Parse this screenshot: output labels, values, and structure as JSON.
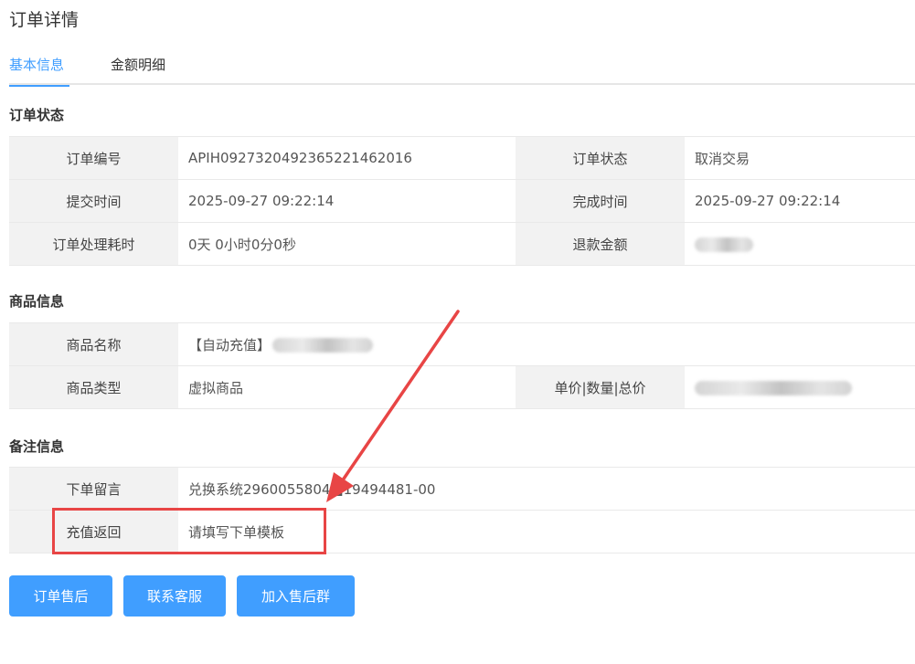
{
  "page": {
    "title": "订单详情"
  },
  "tabs": [
    {
      "label": "基本信息",
      "active": true
    },
    {
      "label": "金额明细",
      "active": false
    }
  ],
  "order_status": {
    "title": "订单状态",
    "order_no_label": "订单编号",
    "order_no": "APIH0927320492365221462016",
    "status_label": "订单状态",
    "status": "取消交易",
    "submit_time_label": "提交时间",
    "submit_time": "2025-09-27 09:22:14",
    "finish_time_label": "完成时间",
    "finish_time": "2025-09-27 09:22:14",
    "duration_label": "订单处理耗时",
    "duration": "0天 0小时0分0秒",
    "refund_label": "退款金额"
  },
  "product_info": {
    "title": "商品信息",
    "name_label": "商品名称",
    "name_prefix": "【自动充值】",
    "type_label": "商品类型",
    "type": "虚拟商品",
    "price_label": "单价|数量|总价"
  },
  "remark_info": {
    "title": "备注信息",
    "message_label": "下单留言",
    "message": "兑换系统2960055804■19494481-00",
    "recharge_label": "充值返回",
    "recharge": "请填写下单模板"
  },
  "buttons": {
    "aftersale": "订单售后",
    "contact": "联系客服",
    "group": "加入售后群"
  },
  "colors": {
    "accent": "#409eff",
    "annotation": "#e84545"
  }
}
